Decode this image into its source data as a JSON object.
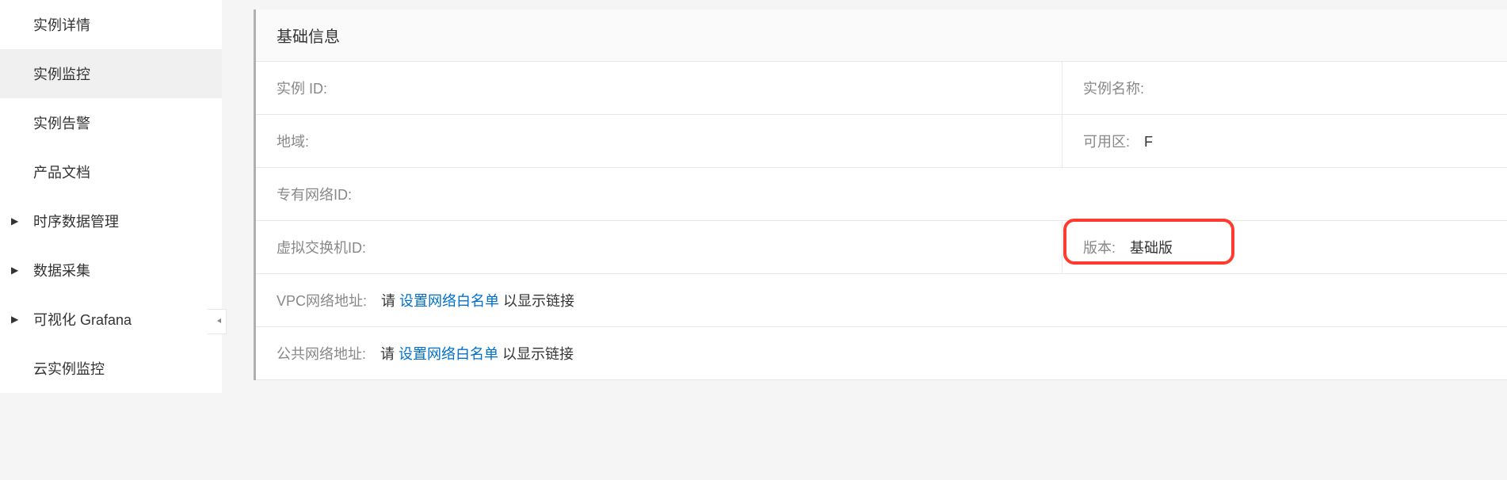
{
  "sidebar": {
    "items": [
      {
        "label": "实例详情",
        "expandable": false,
        "active": false
      },
      {
        "label": "实例监控",
        "expandable": false,
        "active": true
      },
      {
        "label": "实例告警",
        "expandable": false,
        "active": false
      },
      {
        "label": "产品文档",
        "expandable": false,
        "active": false
      },
      {
        "label": "时序数据管理",
        "expandable": true,
        "active": false
      },
      {
        "label": "数据采集",
        "expandable": true,
        "active": false
      },
      {
        "label": "可视化 Grafana",
        "expandable": true,
        "active": false
      },
      {
        "label": "云实例监控",
        "expandable": false,
        "active": false
      }
    ]
  },
  "panel": {
    "title": "基础信息",
    "rows": {
      "instance_id_label": "实例 ID:",
      "instance_id_value": "",
      "instance_name_label": "实例名称:",
      "instance_name_value": "",
      "region_label": "地域:",
      "region_value": "",
      "zone_label": "可用区:",
      "zone_value": "F",
      "vpc_id_label": "专有网络ID:",
      "vpc_id_value": "",
      "vswitch_id_label": "虚拟交换机ID:",
      "vswitch_id_value": "",
      "edition_label": "版本:",
      "edition_value": "基础版",
      "vpc_addr_label": "VPC网络地址:",
      "public_addr_label": "公共网络地址:",
      "net_pre": "请 ",
      "net_link": "设置网络白名单",
      "net_post": " 以显示链接"
    }
  },
  "collapse_icon": "⇤"
}
